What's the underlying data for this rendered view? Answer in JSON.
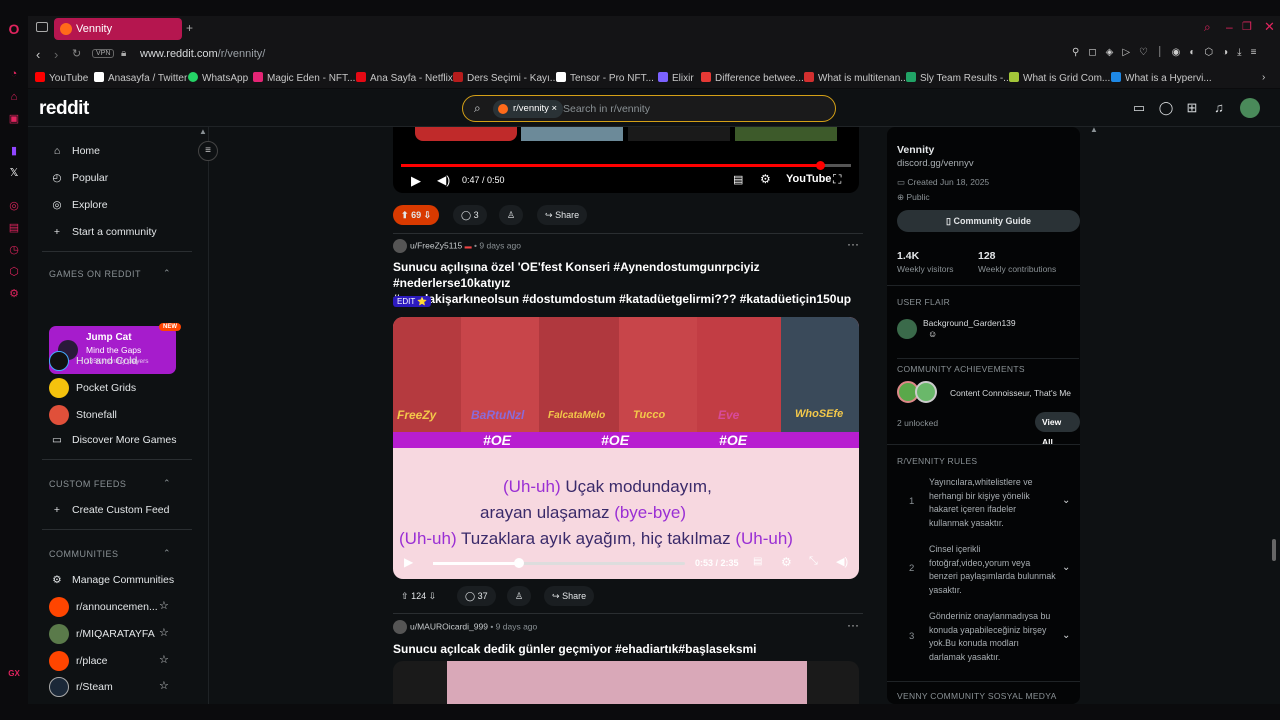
{
  "browser": {
    "tab_title": "Vennity",
    "url_domain": "www.reddit.com",
    "url_path": "/r/vennity/",
    "vpn_label": "VPN"
  },
  "bookmarks": [
    {
      "label": "YouTube",
      "color": "#ff0000"
    },
    {
      "label": "Anasayfa / Twitter",
      "color": "#ffffff"
    },
    {
      "label": "WhatsApp",
      "color": "#25d366"
    },
    {
      "label": "Magic Eden - NFT...",
      "color": "#e42575"
    },
    {
      "label": "Ana Sayfa - Netflix",
      "color": "#e50914"
    },
    {
      "label": "Ders Seçimi - Kayı...",
      "color": "#b71c1c"
    },
    {
      "label": "Tensor - Pro NFT...",
      "color": "#ffffff"
    },
    {
      "label": "Elixir",
      "color": "#7b61ff"
    },
    {
      "label": "Difference betwee...",
      "color": "#e53935"
    },
    {
      "label": "What is multitenan...",
      "color": "#d32f2f"
    },
    {
      "label": "Sly Team Results -...",
      "color": "#21a366"
    },
    {
      "label": "What is Grid Com...",
      "color": "#a4c639"
    },
    {
      "label": "What is a Hypervi...",
      "color": "#1e88e5"
    }
  ],
  "reddit": {
    "logo": "reddit",
    "search_chip": "r/vennity",
    "search_placeholder": "Search in r/vennity"
  },
  "nav": {
    "home": "Home",
    "popular": "Popular",
    "explore": "Explore",
    "start": "Start a community",
    "games_header": "GAMES ON REDDIT",
    "jump_title": "Jump Cat",
    "jump_sub": "Mind the Gaps",
    "jump_users": "135K monthly players",
    "jump_badge": "NEW",
    "hot_cold": "Hot and Cold",
    "pocket": "Pocket Grids",
    "stonefall": "Stonefall",
    "discover": "Discover More Games",
    "custom_header": "CUSTOM FEEDS",
    "create_feed": "Create Custom Feed",
    "communities_header": "COMMUNITIES",
    "manage": "Manage Communities",
    "communities": [
      "r/announcemen...",
      "r/MIQARATAYFA",
      "r/place",
      "r/Steam"
    ]
  },
  "video1": {
    "time": "0:47 / 0:50",
    "brand": "YouTube",
    "upvotes": "69",
    "comments": "3",
    "share": "Share"
  },
  "post2": {
    "user": "u/FreeZy5115",
    "age": "• 9 days ago",
    "title_line1": "Sunucu açılışına özel 'OE'fest Konseri #Aynendostumgunrpciyiz #nederlerse10katıyız",
    "title_line2": "#sıradakişarkıneolsun #dostumdostum #katadüetgelirmi??? #katadüetiçin150up",
    "flair": "EDIT ⭐",
    "names": [
      "FreeZy",
      "BaRtuNzl",
      "FalcataMelo",
      "Tucco",
      "Eve",
      "WhoSEfe"
    ],
    "tag": "#OE",
    "lyric1a": "(Uh-uh)",
    "lyric1b": " Uçak modundayım,",
    "lyric2a": "arayan ulaşamaz ",
    "lyric2b": "(bye-bye)",
    "lyric3a": "(Uh-uh)",
    "lyric3b": " Tuzaklara ayık ayağım, hiç takılmaz ",
    "lyric3c": "(Uh-uh)",
    "time": "0:53 / 2:35",
    "upvotes": "124",
    "comments": "37",
    "share": "Share"
  },
  "post3": {
    "user": "u/MAUROicardi_999",
    "age": "• 9 days ago",
    "title": "Sunucu açılcak dedik günler geçmiyor #ehadiartık#başlaseksmi"
  },
  "sidebar": {
    "name": "Vennity",
    "link": "discord.gg/vennyv",
    "created": "Created Jun 18, 2025",
    "visibility": "Public",
    "guide": "Community Guide",
    "visitors": "1.4K",
    "visitors_label": "Weekly visitors",
    "contrib": "128",
    "contrib_label": "Weekly contributions",
    "flair_header": "USER FLAIR",
    "flair_name": "Background_Garden139",
    "ach_header": "COMMUNITY ACHIEVEMENTS",
    "ach_text": "Content Connoisseur, That's Me",
    "unlocked": "2 unlocked",
    "view_all": "View All",
    "rules_header": "R/VENNITY RULES",
    "rules": [
      {
        "n": "1",
        "text": "Yayıncılara,whitelistlere ve herhangi bir kişiye yönelik hakaret içeren ifadeler kullanmak yasaktır."
      },
      {
        "n": "2",
        "text": "Cinsel içerikli fotoğraf,video,yorum veya benzeri paylaşımlarda bulunmak yasaktır."
      },
      {
        "n": "3",
        "text": "Gönderiniz onaylanmadıysa bu konuda yapabileceğiniz birşey yok.Bu konuda modları darlamak yasaktır."
      }
    ],
    "social_header": "VENNY COMMUNITY SOSYAL MEDYA"
  },
  "opera": {
    "gx_label": "GX"
  }
}
